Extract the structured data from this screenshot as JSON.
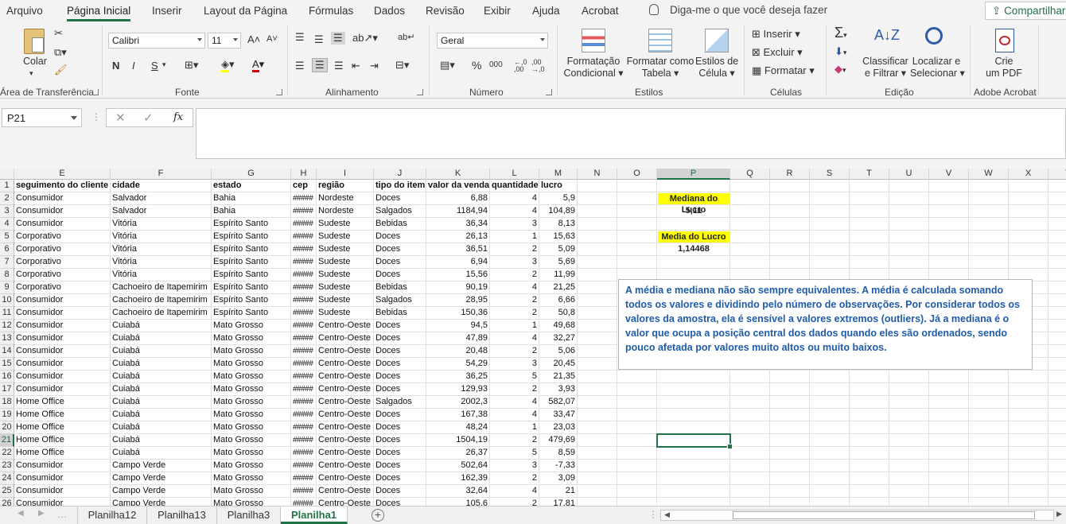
{
  "menu": {
    "tabs": [
      "Arquivo",
      "Página Inicial",
      "Inserir",
      "Layout da Página",
      "Fórmulas",
      "Dados",
      "Revisão",
      "Exibir",
      "Ajuda",
      "Acrobat"
    ],
    "tell_me": "Diga-me o que você deseja fazer",
    "share": "Compartilhar"
  },
  "ribbon": {
    "clipboard": {
      "paste": "Colar",
      "label": "Área de Transferência"
    },
    "font": {
      "name": "Calibri",
      "size": "11",
      "label": "Fonte",
      "bold": "N",
      "italic": "I",
      "underline": "S"
    },
    "alignment": {
      "label": "Alinhamento"
    },
    "number": {
      "format": "Geral",
      "label": "Número",
      "percent": "%",
      "thousands": "000"
    },
    "styles": {
      "conditional": [
        "Formatação",
        "Condicional"
      ],
      "table": [
        "Formatar como",
        "Tabela"
      ],
      "cell": [
        "Estilos de",
        "Célula"
      ],
      "label": "Estilos"
    },
    "cells": {
      "insert": "Inserir",
      "delete": "Excluir",
      "format": "Formatar",
      "label": "Células"
    },
    "editing": {
      "sort": [
        "Classificar",
        "e Filtrar"
      ],
      "find": [
        "Localizar e",
        "Selecionar"
      ],
      "label": "Edição"
    },
    "acrobat": {
      "create": [
        "Crie",
        "um PDF"
      ],
      "label": "Adobe Acrobat"
    }
  },
  "formula_bar": {
    "name_box": "P21",
    "fx": "fx",
    "content": ""
  },
  "sheet": {
    "columns": [
      {
        "id": "E",
        "w": 121
      },
      {
        "id": "F",
        "w": 127
      },
      {
        "id": "G",
        "w": 100
      },
      {
        "id": "H",
        "w": 32
      },
      {
        "id": "I",
        "w": 72
      },
      {
        "id": "J",
        "w": 66
      },
      {
        "id": "K",
        "w": 80
      },
      {
        "id": "L",
        "w": 62
      },
      {
        "id": "M",
        "w": 48
      },
      {
        "id": "N",
        "w": 50
      },
      {
        "id": "O",
        "w": 50
      },
      {
        "id": "P",
        "w": 92
      },
      {
        "id": "Q",
        "w": 50
      },
      {
        "id": "R",
        "w": 50
      },
      {
        "id": "S",
        "w": 50
      },
      {
        "id": "T",
        "w": 50
      },
      {
        "id": "U",
        "w": 50
      },
      {
        "id": "V",
        "w": 50
      },
      {
        "id": "W",
        "w": 50
      },
      {
        "id": "X",
        "w": 50
      },
      {
        "id": "Y",
        "w": 50
      }
    ],
    "headers": [
      "seguimento do cliente",
      "cidade",
      "estado",
      "cep",
      "região",
      "tipo do item",
      "valor da venda",
      "quantidade",
      "lucro"
    ],
    "rows": [
      [
        "Consumidor",
        "Salvador",
        "Bahia",
        "#####",
        "Nordeste",
        "Doces",
        "6,88",
        "4",
        "5,9"
      ],
      [
        "Consumidor",
        "Salvador",
        "Bahia",
        "#####",
        "Nordeste",
        "Salgados",
        "1184,94",
        "4",
        "104,89"
      ],
      [
        "Consumidor",
        "Vitória",
        "Espírito Santo",
        "#####",
        "Sudeste",
        "Bebidas",
        "36,34",
        "3",
        "8,13"
      ],
      [
        "Corporativo",
        "Vitória",
        "Espírito Santo",
        "#####",
        "Sudeste",
        "Doces",
        "26,13",
        "1",
        "15,63"
      ],
      [
        "Corporativo",
        "Vitória",
        "Espírito Santo",
        "#####",
        "Sudeste",
        "Doces",
        "36,51",
        "2",
        "5,09"
      ],
      [
        "Corporativo",
        "Vitória",
        "Espírito Santo",
        "#####",
        "Sudeste",
        "Doces",
        "6,94",
        "3",
        "5,69"
      ],
      [
        "Corporativo",
        "Vitória",
        "Espírito Santo",
        "#####",
        "Sudeste",
        "Doces",
        "15,56",
        "2",
        "11,99"
      ],
      [
        "Corporativo",
        "Cachoeiro de Itapemirim",
        "Espírito Santo",
        "#####",
        "Sudeste",
        "Bebidas",
        "90,19",
        "4",
        "21,25"
      ],
      [
        "Consumidor",
        "Cachoeiro de Itapemirim",
        "Espírito Santo",
        "#####",
        "Sudeste",
        "Salgados",
        "28,95",
        "2",
        "6,66"
      ],
      [
        "Consumidor",
        "Cachoeiro de Itapemirim",
        "Espírito Santo",
        "#####",
        "Sudeste",
        "Bebidas",
        "150,36",
        "2",
        "50,8"
      ],
      [
        "Consumidor",
        "Cuiabá",
        "Mato Grosso",
        "#####",
        "Centro-Oeste",
        "Doces",
        "94,5",
        "1",
        "49,68"
      ],
      [
        "Consumidor",
        "Cuiabá",
        "Mato Grosso",
        "#####",
        "Centro-Oeste",
        "Doces",
        "47,89",
        "4",
        "32,27"
      ],
      [
        "Consumidor",
        "Cuiabá",
        "Mato Grosso",
        "#####",
        "Centro-Oeste",
        "Doces",
        "20,48",
        "2",
        "5,06"
      ],
      [
        "Consumidor",
        "Cuiabá",
        "Mato Grosso",
        "#####",
        "Centro-Oeste",
        "Doces",
        "54,29",
        "3",
        "20,45"
      ],
      [
        "Consumidor",
        "Cuiabá",
        "Mato Grosso",
        "#####",
        "Centro-Oeste",
        "Doces",
        "36,25",
        "5",
        "21,35"
      ],
      [
        "Consumidor",
        "Cuiabá",
        "Mato Grosso",
        "#####",
        "Centro-Oeste",
        "Doces",
        "129,93",
        "2",
        "3,93"
      ],
      [
        "Home Office",
        "Cuiabá",
        "Mato Grosso",
        "#####",
        "Centro-Oeste",
        "Salgados",
        "2002,3",
        "4",
        "582,07"
      ],
      [
        "Home Office",
        "Cuiabá",
        "Mato Grosso",
        "#####",
        "Centro-Oeste",
        "Doces",
        "167,38",
        "4",
        "33,47"
      ],
      [
        "Home Office",
        "Cuiabá",
        "Mato Grosso",
        "#####",
        "Centro-Oeste",
        "Doces",
        "48,24",
        "1",
        "23,03"
      ],
      [
        "Home Office",
        "Cuiabá",
        "Mato Grosso",
        "#####",
        "Centro-Oeste",
        "Doces",
        "1504,19",
        "2",
        "479,69"
      ],
      [
        "Home Office",
        "Cuiabá",
        "Mato Grosso",
        "#####",
        "Centro-Oeste",
        "Doces",
        "26,37",
        "5",
        "8,59"
      ],
      [
        "Consumidor",
        "Campo Verde",
        "Mato Grosso",
        "#####",
        "Centro-Oeste",
        "Doces",
        "502,64",
        "3",
        "-7,33"
      ],
      [
        "Consumidor",
        "Campo Verde",
        "Mato Grosso",
        "#####",
        "Centro-Oeste",
        "Doces",
        "162,39",
        "2",
        "3,09"
      ],
      [
        "Consumidor",
        "Campo Verde",
        "Mato Grosso",
        "#####",
        "Centro-Oeste",
        "Doces",
        "32,64",
        "4",
        "21"
      ],
      [
        "Consumidor",
        "Campo Verde",
        "Mato Grosso",
        "#####",
        "Centro-Oeste",
        "Doces",
        "105,6",
        "2",
        "17,81"
      ]
    ],
    "median_label": "Mediana do Lucro",
    "median_value": "5,11",
    "average_label": "Media do Lucro",
    "average_value": "1,14468",
    "note": "A média e mediana não são sempre equivalentes. A média é calculada somando todos os valores e dividindo pelo número de observações. Por considerar todos os valores da amostra, ela é sensível a valores extremos (outliers). Já a mediana é o valor que ocupa a posição central dos dados quando eles são ordenados, sendo pouco afetada por valores muito altos ou muito baixos.",
    "active_cell": "P21"
  },
  "sheet_tabs": [
    "Planilha12",
    "Planilha13",
    "Planilha3",
    "Planilha1"
  ],
  "active_sheet": "Planilha1",
  "colors": {
    "accent": "#217346",
    "note_text": "#1f5ca8",
    "highlight": "#ffff00"
  }
}
